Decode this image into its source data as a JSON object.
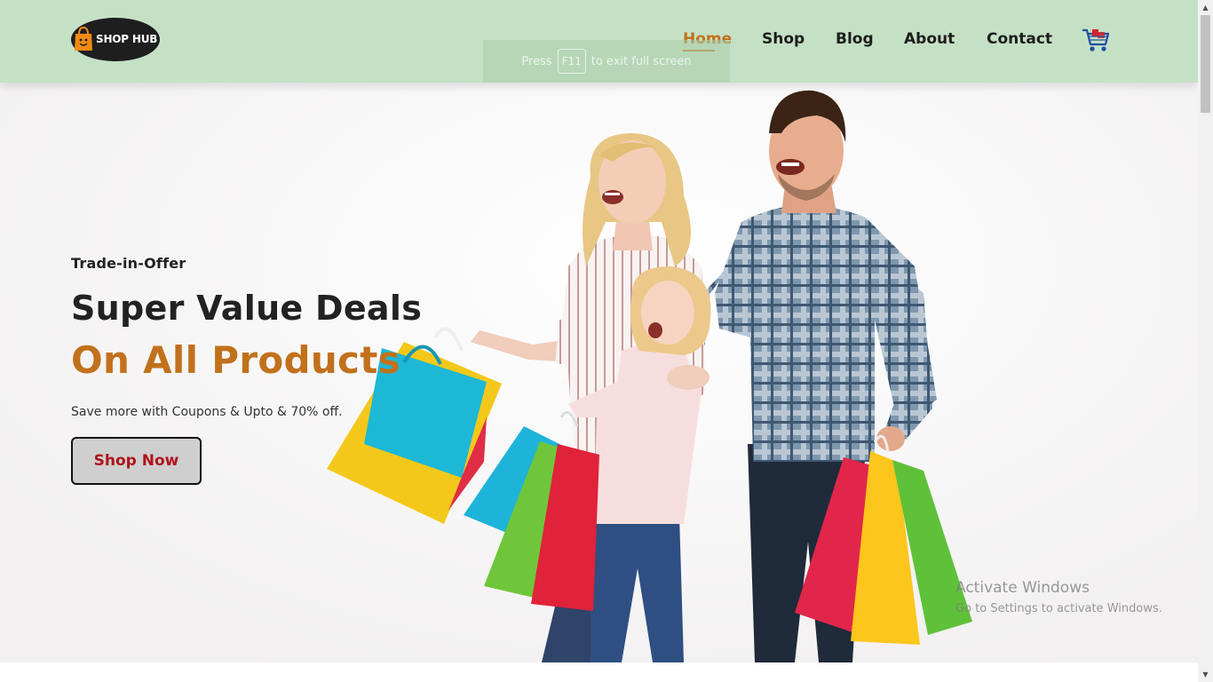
{
  "brand": {
    "logo_text": "SHOP HUB",
    "accent_color": "#c1711c",
    "header_bg": "#c5e1c5"
  },
  "nav": {
    "items": [
      {
        "label": "Home",
        "active": true
      },
      {
        "label": "Shop",
        "active": false
      },
      {
        "label": "Blog",
        "active": false
      },
      {
        "label": "About",
        "active": false
      },
      {
        "label": "Contact",
        "active": false
      }
    ],
    "cart_icon": "shopping-cart-icon"
  },
  "hero": {
    "eyebrow": "Trade-in-Offer",
    "headline": "Super Value Deals",
    "headline_accent": "On All Products",
    "subtext": "Save more with Coupons & Upto & 70% off.",
    "cta_label": "Shop Now",
    "image": "family-with-shopping-bags"
  },
  "overlay": {
    "fullscreen_prefix": "Press",
    "fullscreen_key": "F11",
    "fullscreen_suffix": "to exit full screen"
  },
  "watermark": {
    "title": "Activate Windows",
    "subtitle": "Go to Settings to activate Windows."
  }
}
